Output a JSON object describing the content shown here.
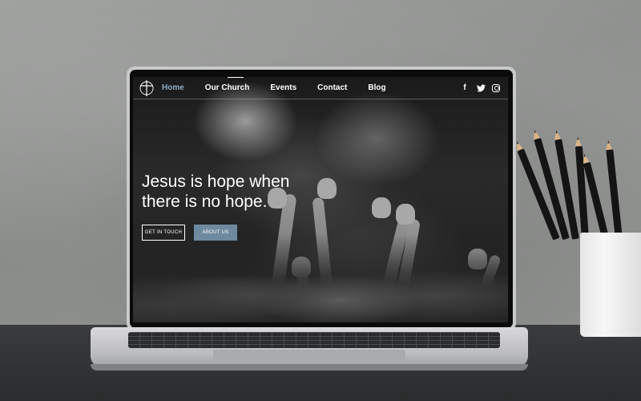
{
  "site": {
    "nav": {
      "logo_icon": "cross-logo-icon",
      "items": [
        {
          "label": "Home",
          "active": true
        },
        {
          "label": "Our Church",
          "active": false
        },
        {
          "label": "Events",
          "active": false
        },
        {
          "label": "Contact",
          "active": false
        },
        {
          "label": "Blog",
          "active": false
        }
      ],
      "social": [
        {
          "icon": "facebook-icon",
          "glyph": "f"
        },
        {
          "icon": "twitter-icon",
          "glyph": "🐦"
        },
        {
          "icon": "instagram-icon",
          "glyph": ""
        }
      ]
    },
    "hero": {
      "headline_line1": "Jesus is hope when",
      "headline_line2": "there is no hope.",
      "primary_button": "GET IN TOUCH",
      "secondary_button": "ABOUT US"
    },
    "colors": {
      "accent": "#8fa9bf",
      "button_fill": "#6e8aa0"
    }
  }
}
